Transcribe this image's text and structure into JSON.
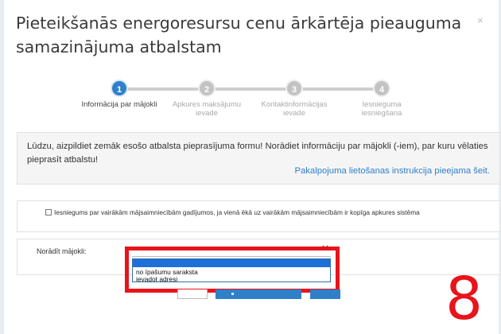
{
  "page": {
    "title": "Pieteikšanās energoresursu cenu ārkārtēja pieauguma samazinājuma atbalstam",
    "close_glyph": "×"
  },
  "stepper": {
    "steps": [
      {
        "number": "1",
        "label": "Informācija par mājokli",
        "state": "active"
      },
      {
        "number": "2",
        "label": "Apkures maksājumu ievade",
        "state": "inactive"
      },
      {
        "number": "3",
        "label": "Kontaktinformācijas ievade",
        "state": "inactive"
      },
      {
        "number": "4",
        "label": "Iesnieguma iesniegšana",
        "state": "inactive"
      }
    ]
  },
  "info": {
    "text": "Lūdzu, aizpildiet zemāk esošo atbalsta pieprasījuma formu! Norādiet informāciju par mājokli (-iem), par kuru vēlaties pieprasīt atbalstu!",
    "link": "Pakalpojuma lietošanas instrukcija pieejama šeit."
  },
  "form": {
    "multi_household_checkbox": {
      "label": "Iesniegums par vairākām mājsaimniecībām gadījumos, ja vienā ēkā uz vairākām mājsaimniecībām ir kopīga apkures sistēma",
      "checked": false
    },
    "property_select": {
      "label": "Norādīt mājokli:",
      "selected_value": "",
      "options": [
        "no īpašumu saraksta",
        "ievadot adresi"
      ]
    }
  },
  "annotation": {
    "number": "8",
    "color": "#e8141b"
  },
  "colors": {
    "accent": "#2f80c9",
    "highlight": "#1e6fd8",
    "annotation": "#e8141b"
  }
}
